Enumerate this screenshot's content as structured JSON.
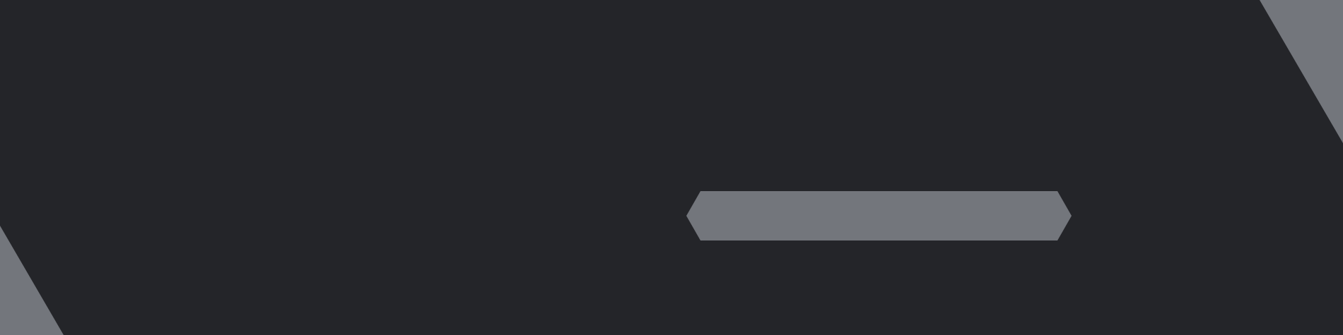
{
  "theme": {
    "background": "#242529",
    "shape_fill": "#73767C"
  },
  "shapes": {
    "top_right_corner": "decorative-chevron",
    "bottom_left_corner": "decorative-chevron",
    "center_bar": "hexagonal-bar"
  }
}
